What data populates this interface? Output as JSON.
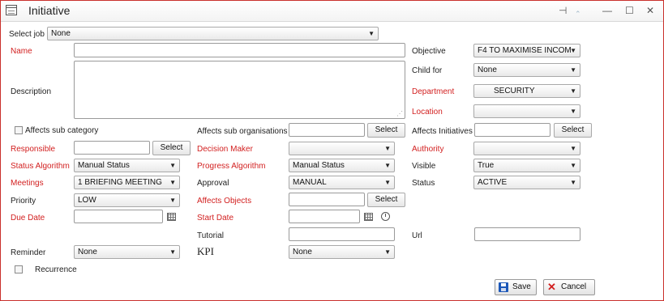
{
  "window": {
    "title": "Initiative",
    "pin_glyph": "⊣",
    "minimize_glyph": "—",
    "maximize_glyph": "☐",
    "close_glyph": "✕"
  },
  "form": {
    "select_job": {
      "label": "Select job",
      "value": "None"
    },
    "name": {
      "label": "Name",
      "value": ""
    },
    "description": {
      "label": "Description",
      "value": ""
    },
    "objective": {
      "label": "Objective",
      "value": "F4 TO MAXIMISE INCOM"
    },
    "child_for": {
      "label": "Child for",
      "value": "None"
    },
    "department": {
      "label": "Department",
      "value": "SECURITY"
    },
    "location": {
      "label": "Location",
      "value": ""
    },
    "affects_sub_category": {
      "label": "Affects sub category",
      "checked": false
    },
    "affects_sub_organisations": {
      "label": "Affects sub organisations",
      "value": "",
      "button": "Select"
    },
    "affects_initiatives": {
      "label": "Affects Initiatives",
      "value": "",
      "button": "Select"
    },
    "responsible": {
      "label": "Responsible",
      "value": "",
      "button": "Select"
    },
    "decision_maker": {
      "label": "Decision Maker",
      "value": ""
    },
    "authority": {
      "label": "Authority",
      "value": ""
    },
    "status_algorithm": {
      "label": "Status Algorithm",
      "value": "Manual Status"
    },
    "progress_algorithm": {
      "label": "Progress Algorithm",
      "value": "Manual Status"
    },
    "visible": {
      "label": "Visible",
      "value": "True"
    },
    "meetings": {
      "label": "Meetings",
      "value": "1 BRIEFING MEETING"
    },
    "approval": {
      "label": "Approval",
      "value": "MANUAL"
    },
    "status": {
      "label": "Status",
      "value": "ACTIVE"
    },
    "priority": {
      "label": "Priority",
      "value": "LOW"
    },
    "affects_objects": {
      "label": "Affects Objects",
      "value": "",
      "button": "Select"
    },
    "due_date": {
      "label": "Due Date",
      "value": ""
    },
    "start_date": {
      "label": "Start Date",
      "value": ""
    },
    "tutorial": {
      "label": "Tutorial",
      "value": ""
    },
    "url": {
      "label": "Url",
      "value": ""
    },
    "reminder": {
      "label": "Reminder",
      "value": "None"
    },
    "kpi": {
      "label": "KPI",
      "value": "None"
    },
    "recurrence": {
      "label": "Recurrence",
      "checked": false
    }
  },
  "actions": {
    "save": "Save",
    "cancel": "Cancel"
  },
  "icons": {
    "calendar": "calendar-icon",
    "alarm": "alarm-clock-icon",
    "dropdown": "▼",
    "save": "save-icon",
    "cancel": "cancel-icon"
  },
  "colors": {
    "required_label": "#d21f1f",
    "window_border": "#c9302c",
    "save_icon": "#1b57b8"
  }
}
